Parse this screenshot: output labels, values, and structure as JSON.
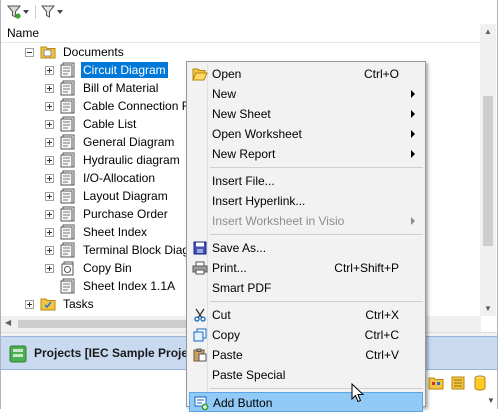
{
  "toolbar": {
    "filter_icon": "filter-icon",
    "filter_clear_icon": "filter-clear-icon",
    "dropdown_icon": "dropdown-arrow-icon"
  },
  "column_header": "Name",
  "tree": {
    "root": {
      "label": "Documents",
      "icon": "folder-document-icon",
      "expanded": true
    },
    "items": [
      {
        "label": "Circuit Diagram",
        "icon": "document-sheet-icon",
        "expandable": true,
        "selected": true
      },
      {
        "label": "Bill of Material",
        "icon": "document-sheet-icon",
        "expandable": true
      },
      {
        "label": "Cable Connection R",
        "icon": "document-sheet-icon",
        "expandable": true
      },
      {
        "label": "Cable List",
        "icon": "document-sheet-icon",
        "expandable": true
      },
      {
        "label": "General Diagram",
        "icon": "document-sheet-icon",
        "expandable": true
      },
      {
        "label": "Hydraulic diagram",
        "icon": "document-sheet-icon",
        "expandable": true
      },
      {
        "label": "I/O-Allocation",
        "icon": "document-sheet-icon",
        "expandable": true
      },
      {
        "label": "Layout Diagram",
        "icon": "document-sheet-icon",
        "expandable": true
      },
      {
        "label": "Purchase Order",
        "icon": "document-sheet-icon",
        "expandable": true
      },
      {
        "label": "Sheet Index",
        "icon": "document-sheet-icon",
        "expandable": true
      },
      {
        "label": "Terminal Block Diag",
        "icon": "document-sheet-icon",
        "expandable": true
      },
      {
        "label": "Copy Bin",
        "icon": "copy-bin-icon",
        "expandable": true
      },
      {
        "label": "Sheet Index 1.1A",
        "icon": "document-sheet-icon",
        "expandable": false
      }
    ],
    "tasks": {
      "label": "Tasks",
      "icon": "tasks-folder-icon"
    }
  },
  "projects_bar": {
    "title": "Projects [IEC Sample Projec",
    "icon": "projects-icon"
  },
  "bottom_tools": [
    "folder-icon",
    "database-icon",
    "cylinder-icon"
  ],
  "context_menu": {
    "items": [
      {
        "label": "Open",
        "shortcut": "Ctrl+O",
        "icon": "open-folder-icon"
      },
      {
        "label": "New",
        "submenu": true
      },
      {
        "label": "New Sheet",
        "submenu": true
      },
      {
        "label": "Open Worksheet",
        "submenu": true
      },
      {
        "label": "New Report",
        "submenu": true
      },
      {
        "separator": true
      },
      {
        "label": "Insert File..."
      },
      {
        "label": "Insert Hyperlink..."
      },
      {
        "label": "Insert Worksheet in Visio",
        "submenu": true,
        "disabled": true
      },
      {
        "separator": true
      },
      {
        "label": "Save As...",
        "icon": "save-icon"
      },
      {
        "label": "Print...",
        "shortcut": "Ctrl+Shift+P",
        "icon": "print-icon"
      },
      {
        "label": "Smart PDF"
      },
      {
        "separator": true
      },
      {
        "label": "Cut",
        "shortcut": "Ctrl+X",
        "icon": "scissors-icon"
      },
      {
        "label": "Copy",
        "shortcut": "Ctrl+C",
        "icon": "copy-icon"
      },
      {
        "label": "Paste",
        "shortcut": "Ctrl+V",
        "icon": "paste-icon"
      },
      {
        "label": "Paste Special"
      },
      {
        "separator": true
      },
      {
        "label": "Add Button",
        "icon": "add-button-icon",
        "highlighted": true
      }
    ]
  },
  "colors": {
    "selection": "#0078d7",
    "menu_highlight": "#91c9f7",
    "projects_bar": "#c9daf0"
  }
}
